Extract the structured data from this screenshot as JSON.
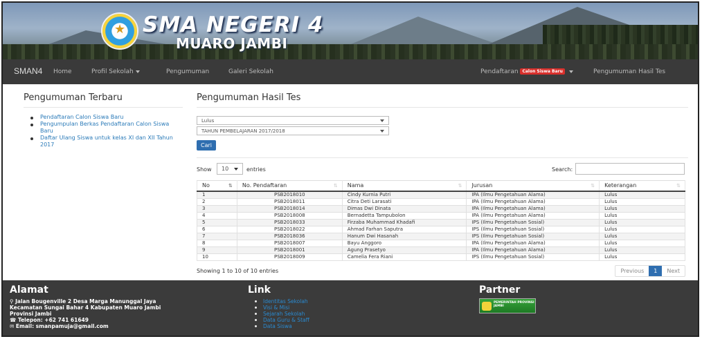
{
  "header": {
    "school_name": "SMA NEGERI 4",
    "school_city": "MUARO JAMBI"
  },
  "navbar": {
    "brand": "SMAN4",
    "items": [
      {
        "label": "Home"
      },
      {
        "label": "Profil Sekolah"
      },
      {
        "label": "Pengumuman"
      },
      {
        "label": "Galeri Sekolah"
      }
    ],
    "right_items": [
      {
        "label": "Pendaftaran",
        "badge": "Calon Siswa Baru"
      },
      {
        "label": "Pengumuman Hasil Tes"
      }
    ]
  },
  "sidebar": {
    "title": "Pengumuman Terbaru",
    "links": [
      "Pendaftaran Calon Siswa Baru",
      "Pengumpulan Berkas Pendaftaran Calon Siswa Baru",
      "Daftar Ulang Siswa untuk kelas XI dan XII Tahun 2017"
    ]
  },
  "main": {
    "title": "Pengumuman Hasil Tes",
    "filter_status": "Lulus",
    "filter_year": "TAHUN PEMBELAJARAN 2017/2018",
    "search_button": "Cari",
    "show_label": "Show",
    "show_value": "10",
    "entries_label": "entries",
    "search_label": "Search:",
    "columns": [
      "No",
      "No. Pendaftaran",
      "Nama",
      "Jurusan",
      "Keterangan"
    ],
    "rows": [
      [
        "1",
        "PSB2018010",
        "Cindy Kurnia Putri",
        "IPA (Ilmu Pengetahuan Alama)",
        "Lulus"
      ],
      [
        "2",
        "PSB2018011",
        "Citra Deti Larasati",
        "IPA (Ilmu Pengetahuan Alama)",
        "Lulus"
      ],
      [
        "3",
        "PSB2018014",
        "Dimas Dwi Dinata",
        "IPA (Ilmu Pengetahuan Alama)",
        "Lulus"
      ],
      [
        "4",
        "PSB2018008",
        "Bernadetta Tampubolon",
        "IPA (Ilmu Pengetahuan Alama)",
        "Lulus"
      ],
      [
        "5",
        "PSB2018033",
        "Firzaba Muhammad Khadafi",
        "IPS (Ilmu Pengetahuan Sosial)",
        "Lulus"
      ],
      [
        "6",
        "PSB2018022",
        "Ahmad Farhan Saputra",
        "IPS (Ilmu Pengetahuan Sosial)",
        "Lulus"
      ],
      [
        "7",
        "PSB2018036",
        "Hanum Dwi Hasanah",
        "IPS (Ilmu Pengetahuan Sosial)",
        "Lulus"
      ],
      [
        "8",
        "PSB2018007",
        "Bayu Anggoro",
        "IPA (Ilmu Pengetahuan Alama)",
        "Lulus"
      ],
      [
        "9",
        "PSB2018001",
        "Agung Prasetyo",
        "IPA (Ilmu Pengetahuan Alama)",
        "Lulus"
      ],
      [
        "10",
        "PSB2018009",
        "Camelia Fera Riani",
        "IPS (Ilmu Pengetahuan Sosial)",
        "Lulus"
      ]
    ],
    "info": "Showing 1 to 10 of 10 entries",
    "pager": {
      "previous": "Previous",
      "page": "1",
      "next": "Next"
    }
  },
  "footer": {
    "address_title": "Alamat",
    "address_line1": "Jalan Bougenville 2 Desa Marga Manunggal Jaya",
    "address_line2": "Kecamatan Sungai Bahar 4 Kabupaten Muaro Jambi",
    "address_line3": "Provinsi Jambi",
    "phone": "Telepon: +62 741 61649",
    "email": "Email: smanpamuja@gmail.com",
    "link_title": "Link",
    "links": [
      "Identitas Sekolah",
      "Visi & Misi",
      "Sejarah Sekolah",
      "Data Guru & Staff",
      "Data Siswa"
    ],
    "partner_title": "Partner",
    "partner_logo_text": "PEMERINTAH PROVINSI JAMBI"
  },
  "colors": {
    "navbar_bg": "#3a3a3a",
    "footer_bg": "#3b3b3b",
    "accent": "#2f6eb0",
    "badge": "#d9302c",
    "link": "#2a7ab8"
  }
}
